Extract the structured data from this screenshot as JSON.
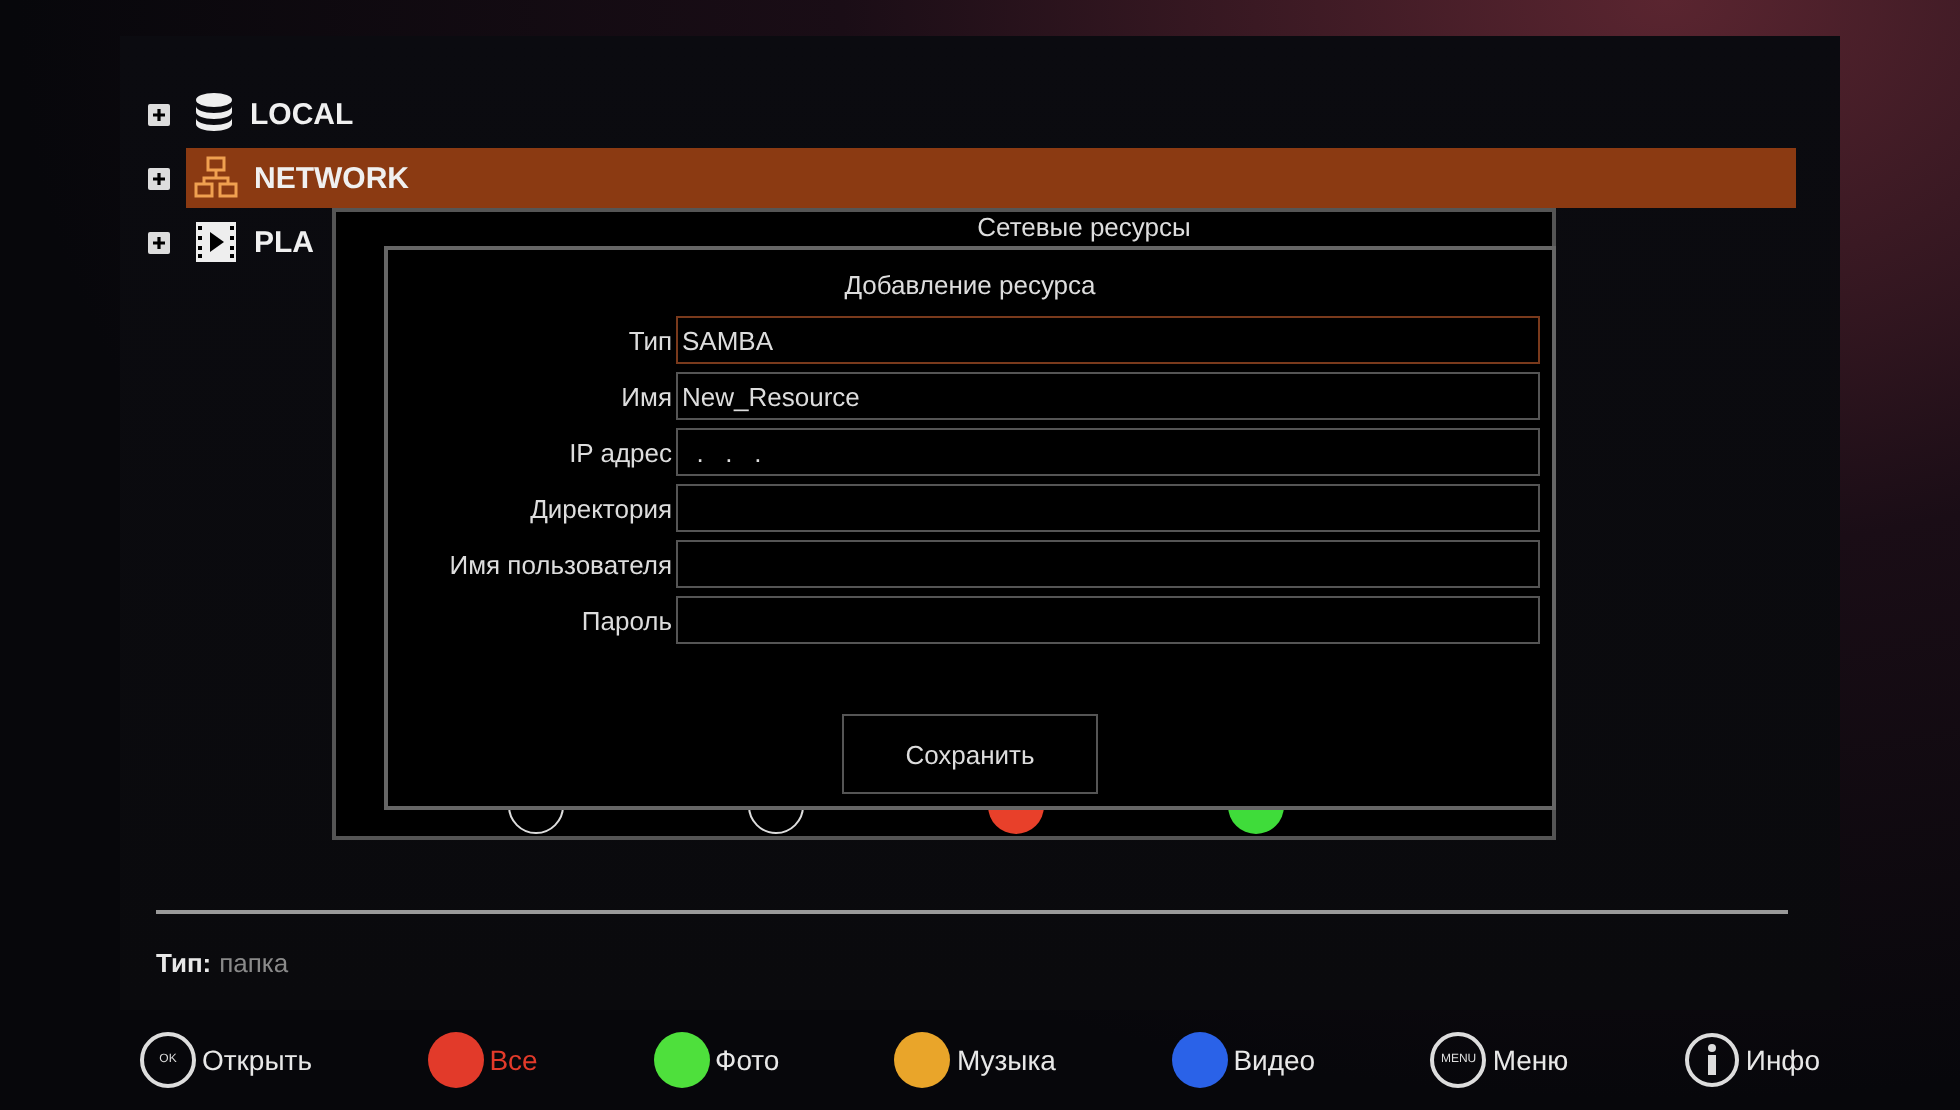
{
  "tree": [
    {
      "label": "LOCAL",
      "kind": "storage",
      "selected": false
    },
    {
      "label": "NETWORK",
      "kind": "network",
      "selected": true
    },
    {
      "label": "PLA",
      "kind": "film",
      "selected": false
    }
  ],
  "outer_dialog": {
    "title": "Сетевые ресурсы",
    "buttons": [
      {
        "kind": "outline"
      },
      {
        "kind": "outline"
      },
      {
        "kind": "dot",
        "color": "#e8402a"
      },
      {
        "kind": "dot",
        "color": "#3fdc3a"
      }
    ]
  },
  "dialog": {
    "title": "Добавление ресурса",
    "fields": [
      {
        "label": "Тип",
        "value": "SAMBA",
        "focused": true
      },
      {
        "label": "Имя",
        "value": "New_Resource",
        "focused": false
      },
      {
        "label": "IP адрес",
        "value": "  .   .   .",
        "focused": false
      },
      {
        "label": "Директория",
        "focused": false
      },
      {
        "label": "Имя пользователя",
        "focused": false
      },
      {
        "label": "Пароль",
        "focused": false
      }
    ],
    "save_button": "Сохранить"
  },
  "status": {
    "label": "Тип:",
    "value": "папка"
  },
  "hints": [
    {
      "kind": "ok",
      "badge": "OK",
      "label": "Открыть",
      "selected": false
    },
    {
      "kind": "dot",
      "color": "#e23a2a",
      "label": "Все",
      "selected": true
    },
    {
      "kind": "dot",
      "color": "#4ee03c",
      "label": "Фото",
      "selected": false
    },
    {
      "kind": "dot",
      "color": "#e9a52a",
      "label": "Музыка",
      "selected": false
    },
    {
      "kind": "dot",
      "color": "#2a62e8",
      "label": "Видео",
      "selected": false
    },
    {
      "kind": "ok",
      "badge": "MENU",
      "label": "Меню",
      "selected": false
    },
    {
      "kind": "info",
      "label": "Инфо",
      "selected": false
    }
  ]
}
